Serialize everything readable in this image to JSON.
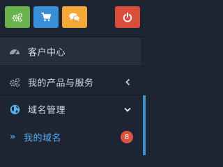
{
  "toolbar": {
    "buttons": [
      {
        "icon": "gears-icon",
        "color": "#69b24e"
      },
      {
        "icon": "cart-icon",
        "color": "#3a8fd9"
      },
      {
        "icon": "chat-icon",
        "color": "#f5a738"
      },
      {
        "icon": "power-icon",
        "color": "#d94d3b"
      }
    ]
  },
  "nav": {
    "items": [
      {
        "label": "客户中心",
        "icon": "dashboard-icon"
      },
      {
        "label": "我的产品与服务",
        "icon": "gears-icon",
        "chevron": "left"
      },
      {
        "label": "域名管理",
        "icon": "globe-icon",
        "chevron": "down"
      }
    ],
    "subitems": [
      {
        "label": "我的域名",
        "prefix": "»",
        "badge": "8"
      }
    ]
  },
  "colors": {
    "sidebar_bg": "#1d2532",
    "active_bg": "#262f3c",
    "link_blue": "#58aef0",
    "badge_red": "#d9533f",
    "scrollbar": "#3c8fd5"
  }
}
